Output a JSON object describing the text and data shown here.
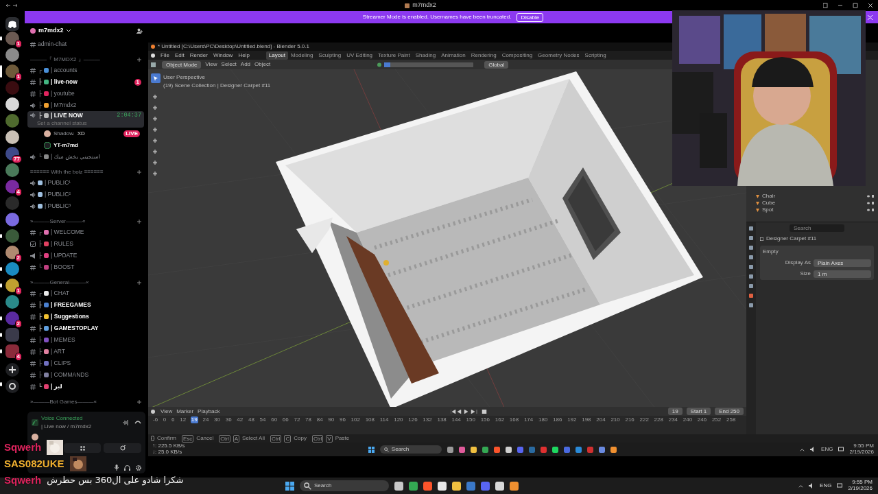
{
  "window": {
    "title": "m7mdx2"
  },
  "banner": {
    "message": "Streamer Mode is enabled. Usernames have been truncated.",
    "button": "Disable"
  },
  "servers": [
    {
      "kind": "home",
      "selected": false,
      "unread": false
    },
    {
      "kind": "server",
      "color": "#6b5a52",
      "badge": "1",
      "selected": false,
      "unread": true
    },
    {
      "kind": "server",
      "color": "#8a8a8a",
      "selected": false,
      "unread": false
    },
    {
      "kind": "server",
      "color": "#6e5a3a",
      "badge": "1",
      "selected": true,
      "unread": false
    },
    {
      "kind": "server",
      "color": "#3a0c10",
      "selected": false,
      "unread": false
    },
    {
      "kind": "server",
      "color": "#d8d8d8",
      "selected": false,
      "unread": false
    },
    {
      "kind": "server",
      "color": "#4f6a2e",
      "selected": false,
      "unread": false
    },
    {
      "kind": "server",
      "color": "#c9c0b5",
      "selected": false,
      "unread": false
    },
    {
      "kind": "server",
      "color": "#3e4a8a",
      "badge": "77",
      "selected": false,
      "unread": false
    },
    {
      "kind": "server",
      "color": "#4a7a5a",
      "selected": false,
      "unread": false
    },
    {
      "kind": "server",
      "color": "#7a2aa0",
      "badge": "4",
      "selected": false,
      "unread": false
    },
    {
      "kind": "server",
      "color": "#2a2a2a",
      "selected": false,
      "unread": false
    },
    {
      "kind": "server",
      "color": "#7a6ae0",
      "selected": false,
      "unread": false
    },
    {
      "kind": "server",
      "color": "#3a5a3a",
      "selected": false,
      "unread": true
    },
    {
      "kind": "server",
      "color": "#b08a70",
      "badge": "2",
      "selected": false,
      "unread": false
    },
    {
      "kind": "server",
      "color": "#1a8ac0",
      "selected": false,
      "unread": true
    },
    {
      "kind": "server",
      "color": "#c0a030",
      "badge": "1",
      "selected": false,
      "unread": true
    },
    {
      "kind": "server",
      "color": "#2a8a8a",
      "selected": false,
      "unread": false
    },
    {
      "kind": "server",
      "color": "#5a2aa0",
      "badge": "2",
      "selected": false,
      "unread": true
    },
    {
      "kind": "folder",
      "color": "#3a3a4a",
      "selected": false,
      "unread": true
    },
    {
      "kind": "folder",
      "color": "#8a2a3a",
      "badge": "4",
      "selected": false,
      "unread": true
    },
    {
      "kind": "add",
      "selected": false,
      "unread": false
    },
    {
      "kind": "discover",
      "selected": false,
      "unread": true
    }
  ],
  "server_name": "m7mdx2",
  "channels": [
    {
      "kind": "text",
      "name": "admin-chat",
      "unread": false,
      "selected": false
    },
    {
      "kind": "category",
      "name": "———『 M7MDX2 』———"
    },
    {
      "kind": "text",
      "branch": "┌",
      "color": "#4a90d9",
      "name": "| accounts",
      "unread": false,
      "selected": false
    },
    {
      "kind": "text",
      "branch": "├",
      "color": "#43b581",
      "name": "| live-now",
      "unread": true,
      "selected": false,
      "badge": "1"
    },
    {
      "kind": "text",
      "branch": "├",
      "color": "#e0245e",
      "name": "| youtube",
      "unread": false,
      "selected": false
    },
    {
      "kind": "voice",
      "branch": "├",
      "color": "#f0a030",
      "name": "| M7mdx2",
      "unread": false,
      "selected": false
    },
    {
      "kind": "voice",
      "branch": "├",
      "color": "#b8b8b8",
      "name": "| LIVE NOW",
      "unread": true,
      "selected": true,
      "time": "2:04:37",
      "status": "Set a channel status",
      "members": [
        {
          "name": "Shadow.",
          "tag": "XD",
          "badge": "LIVE"
        },
        {
          "name": "YT-m7md"
        }
      ]
    },
    {
      "kind": "voice",
      "branch": "└",
      "color": "#888888",
      "name": "| استجيني يخش ميك",
      "unread": false,
      "selected": false
    },
    {
      "kind": "category",
      "name": "≡≡≡≡≡≡ With the boiz ≡≡≡≡≡≡"
    },
    {
      "kind": "voice",
      "color": "#a0c0e0",
      "name": "| PUBLIC¹",
      "unread": false,
      "selected": false
    },
    {
      "kind": "voice",
      "color": "#a0c0e0",
      "name": "| PUBLIC²",
      "unread": false,
      "selected": false
    },
    {
      "kind": "voice",
      "color": "#a0c0e0",
      "name": "| PUBLIC³",
      "unread": false,
      "selected": false
    },
    {
      "kind": "category",
      "name": "»———Server———«"
    },
    {
      "kind": "text",
      "branch": "┌",
      "color": "#e070b0",
      "name": "| WELCOME",
      "unread": false,
      "selected": false
    },
    {
      "kind": "rules",
      "branch": "├",
      "color": "#e04060",
      "name": "| RULES",
      "unread": false,
      "selected": false
    },
    {
      "kind": "announce",
      "branch": "├",
      "color": "#e04080",
      "name": "| UPDATE",
      "unread": false,
      "selected": false
    },
    {
      "kind": "text",
      "branch": "└",
      "color": "#c04080",
      "name": "| BOOST",
      "unread": false,
      "selected": false
    },
    {
      "kind": "category",
      "name": "»———General———«"
    },
    {
      "kind": "text",
      "branch": "┌",
      "color": "#e8e8e8",
      "name": "| CHAT",
      "unread": false,
      "selected": false
    },
    {
      "kind": "text",
      "branch": "├",
      "color": "#4a80d0",
      "name": "| FREEGAMES",
      "unread": true,
      "selected": false
    },
    {
      "kind": "text",
      "branch": "├",
      "color": "#f0c030",
      "name": "| Suggestions",
      "unread": true,
      "selected": false
    },
    {
      "kind": "text",
      "branch": "├",
      "color": "#60a0e0",
      "name": "| GAMESTOPLAY",
      "unread": true,
      "selected": false
    },
    {
      "kind": "text",
      "branch": "├",
      "color": "#8050c0",
      "name": "| MEMES",
      "unread": false,
      "selected": false
    },
    {
      "kind": "text",
      "branch": "├",
      "color": "#e080a0",
      "name": "| ART",
      "unread": false,
      "selected": false
    },
    {
      "kind": "text",
      "branch": "├",
      "color": "#7070c0",
      "name": "| CLIPS",
      "unread": false,
      "selected": false
    },
    {
      "kind": "text",
      "branch": "├",
      "color": "#8080a0",
      "name": "| COMMANDS",
      "unread": false,
      "selected": false
    },
    {
      "kind": "text",
      "branch": "└",
      "color": "#e04070",
      "name": "| لبر",
      "unread": true,
      "selected": false
    },
    {
      "kind": "category",
      "name": "»———Bot Games———«"
    }
  ],
  "voice_panel": {
    "title": "Voice Connected",
    "channel": "| Live now / m7mdx2"
  },
  "chat_overlay": [
    {
      "kind": "picture",
      "user": "Sqwerh",
      "color": "#e0245e"
    },
    {
      "kind": "picture",
      "user": "SAS082UKE",
      "color": "#f0b030"
    },
    {
      "kind": "message",
      "user": "Sqwerh",
      "color": "#e0245e",
      "message": "شكرا شادو على ال360 بس حطرش"
    }
  ],
  "blender": {
    "title": "* Untitled [C:\\Users\\PC\\Desktop\\Untitled.blend] - Blender 5.0.1",
    "menus": [
      "File",
      "Edit",
      "Render",
      "Window",
      "Help"
    ],
    "workspaces": [
      {
        "label": "Layout",
        "selected": true
      },
      {
        "label": "Modeling",
        "selected": false
      },
      {
        "label": "Sculpting",
        "selected": false
      },
      {
        "label": "UV Editing",
        "selected": false
      },
      {
        "label": "Texture Paint",
        "selected": false
      },
      {
        "label": "Shading",
        "selected": false
      },
      {
        "label": "Animation",
        "selected": false
      },
      {
        "label": "Rendering",
        "selected": false
      },
      {
        "label": "Compositing",
        "selected": false
      },
      {
        "label": "Geometry Nodes",
        "selected": false
      },
      {
        "label": "Scripting",
        "selected": false
      }
    ],
    "header": {
      "mode": "Object Mode",
      "menus": [
        "View",
        "Select",
        "Add",
        "Object"
      ],
      "orientation": "Global"
    },
    "viewport": {
      "view": "User Perspective",
      "collection": "(19) Scene Collection | Designer Carpet #11"
    },
    "outliner": [
      {
        "name": "Chair"
      },
      {
        "name": "Cube"
      },
      {
        "name": "Spot"
      }
    ],
    "properties": {
      "search": "Search",
      "object": "Designer Carpet #11",
      "panel": "Empty",
      "fields": [
        {
          "label": "Display As",
          "value": "Plain Axes"
        },
        {
          "label": "Size",
          "value": "1 m"
        }
      ]
    },
    "timeline": {
      "menus": [
        "View",
        "Marker",
        "Playback"
      ],
      "frame": "19",
      "start_label": "Start",
      "start": "1",
      "end_label": "End",
      "end": "250",
      "ticks": [
        {
          "label": "-6",
          "current": false
        },
        {
          "label": "0",
          "current": false
        },
        {
          "label": "6",
          "current": false
        },
        {
          "label": "12",
          "current": false
        },
        {
          "label": "19",
          "current": true
        },
        {
          "label": "24",
          "current": false
        },
        {
          "label": "30",
          "current": false
        },
        {
          "label": "36",
          "current": false
        },
        {
          "label": "42",
          "current": false
        },
        {
          "label": "48",
          "current": false
        },
        {
          "label": "54",
          "current": false
        },
        {
          "label": "60",
          "current": false
        },
        {
          "label": "66",
          "current": false
        },
        {
          "label": "72",
          "current": false
        },
        {
          "label": "78",
          "current": false
        },
        {
          "label": "84",
          "current": false
        },
        {
          "label": "90",
          "current": false
        },
        {
          "label": "96",
          "current": false
        },
        {
          "label": "102",
          "current": false
        },
        {
          "label": "108",
          "current": false
        },
        {
          "label": "114",
          "current": false
        },
        {
          "label": "120",
          "current": false
        },
        {
          "label": "126",
          "current": false
        },
        {
          "label": "132",
          "current": false
        },
        {
          "label": "138",
          "current": false
        },
        {
          "label": "144",
          "current": false
        },
        {
          "label": "150",
          "current": false
        },
        {
          "label": "156",
          "current": false
        },
        {
          "label": "162",
          "current": false
        },
        {
          "label": "168",
          "current": false
        },
        {
          "label": "174",
          "current": false
        },
        {
          "label": "180",
          "current": false
        },
        {
          "label": "186",
          "current": false
        },
        {
          "label": "192",
          "current": false
        },
        {
          "label": "198",
          "current": false
        },
        {
          "label": "204",
          "current": false
        },
        {
          "label": "210",
          "current": false
        },
        {
          "label": "216",
          "current": false
        },
        {
          "label": "222",
          "current": false
        },
        {
          "label": "228",
          "current": false
        },
        {
          "label": "234",
          "current": false
        },
        {
          "label": "240",
          "current": false
        },
        {
          "label": "246",
          "current": false
        },
        {
          "label": "252",
          "current": false
        },
        {
          "label": "258",
          "current": false
        }
      ]
    },
    "status": [
      {
        "label": "Confirm"
      },
      {
        "keys": [
          "Esc"
        ],
        "label": "Cancel"
      },
      {
        "keys": [
          "Ctrl",
          "A"
        ],
        "label": "Select All"
      },
      {
        "keys": [
          "Ctrl",
          "C"
        ],
        "label": "Copy"
      },
      {
        "keys": [
          "Ctrl",
          "V"
        ],
        "label": "Paste"
      }
    ],
    "net": [
      "↑: 225.5 KB/s",
      "↓: 25.0 KB/s"
    ],
    "taskbar": {
      "search": "Search",
      "apps": [
        {
          "color": "#9a9a9a"
        },
        {
          "color": "#e05a9a"
        },
        {
          "color": "#f0c040"
        },
        {
          "color": "#34a853"
        },
        {
          "color": "#fb542b"
        },
        {
          "color": "#d0d0d0"
        },
        {
          "color": "#5865f2"
        },
        {
          "color": "#2a6aa0"
        },
        {
          "color": "#e03030"
        },
        {
          "color": "#1ed760"
        },
        {
          "color": "#4a6ae0"
        },
        {
          "color": "#2a8ad8"
        },
        {
          "color": "#d03030"
        },
        {
          "color": "#6a8ae0"
        },
        {
          "color": "#f09030"
        }
      ],
      "lang": "ENG",
      "time": "9:55 PM",
      "date": "2/19/2026"
    }
  },
  "taskbar": {
    "search": "Search",
    "apps": [
      {
        "color": "#c8c8c8"
      },
      {
        "color": "#34a853"
      },
      {
        "color": "#fb542b"
      },
      {
        "color": "#e8e8e8"
      },
      {
        "color": "#f0c040"
      },
      {
        "color": "#3a78c8"
      },
      {
        "color": "#5865f2"
      },
      {
        "color": "#d8d8d8"
      },
      {
        "color": "#f09030"
      }
    ],
    "lang": "ENG",
    "time": "9:55 PM",
    "date": "2/19/2026"
  }
}
